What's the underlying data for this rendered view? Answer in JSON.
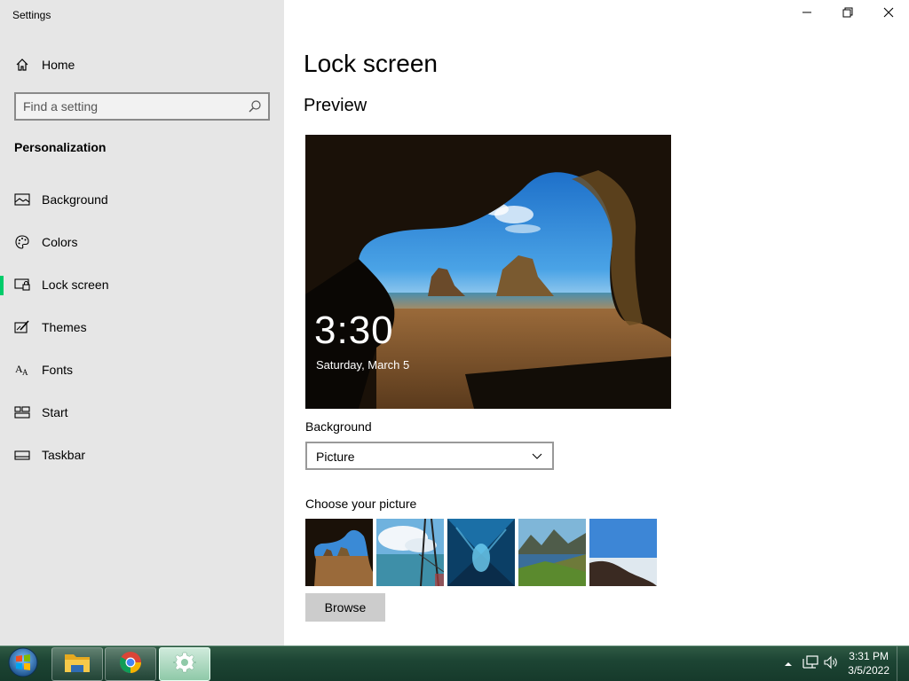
{
  "window": {
    "title": "Settings",
    "minimize_icon": "minimize-icon",
    "restore_icon": "restore-icon",
    "close_icon": "close-icon"
  },
  "sidebar": {
    "home_label": "Home",
    "search_placeholder": "Find a setting",
    "section_title": "Personalization",
    "items": [
      {
        "label": "Background",
        "icon": "picture-icon",
        "selected": false
      },
      {
        "label": "Colors",
        "icon": "palette-icon",
        "selected": false
      },
      {
        "label": "Lock screen",
        "icon": "lock-screen-icon",
        "selected": true
      },
      {
        "label": "Themes",
        "icon": "themes-icon",
        "selected": false
      },
      {
        "label": "Fonts",
        "icon": "fonts-icon",
        "selected": false
      },
      {
        "label": "Start",
        "icon": "start-icon",
        "selected": false
      },
      {
        "label": "Taskbar",
        "icon": "taskbar-icon",
        "selected": false
      }
    ]
  },
  "main": {
    "title": "Lock screen",
    "preview_title": "Preview",
    "preview_time": "3:30",
    "preview_date": "Saturday, March 5",
    "background_label": "Background",
    "background_value": "Picture",
    "choose_label": "Choose your picture",
    "thumbnails": [
      "cave-beach",
      "glass-sky",
      "blue-ice",
      "mountain-lake",
      "cliff-sea"
    ],
    "browse_label": "Browse"
  },
  "taskbar": {
    "apps": [
      "file-explorer",
      "chrome",
      "settings"
    ],
    "active_app": "settings",
    "time": "3:31 PM",
    "date": "3/5/2022"
  },
  "colors": {
    "accent": "#00cc6a",
    "sidebar_bg": "#e6e6e6",
    "taskbar_bg": "#1d4534"
  }
}
